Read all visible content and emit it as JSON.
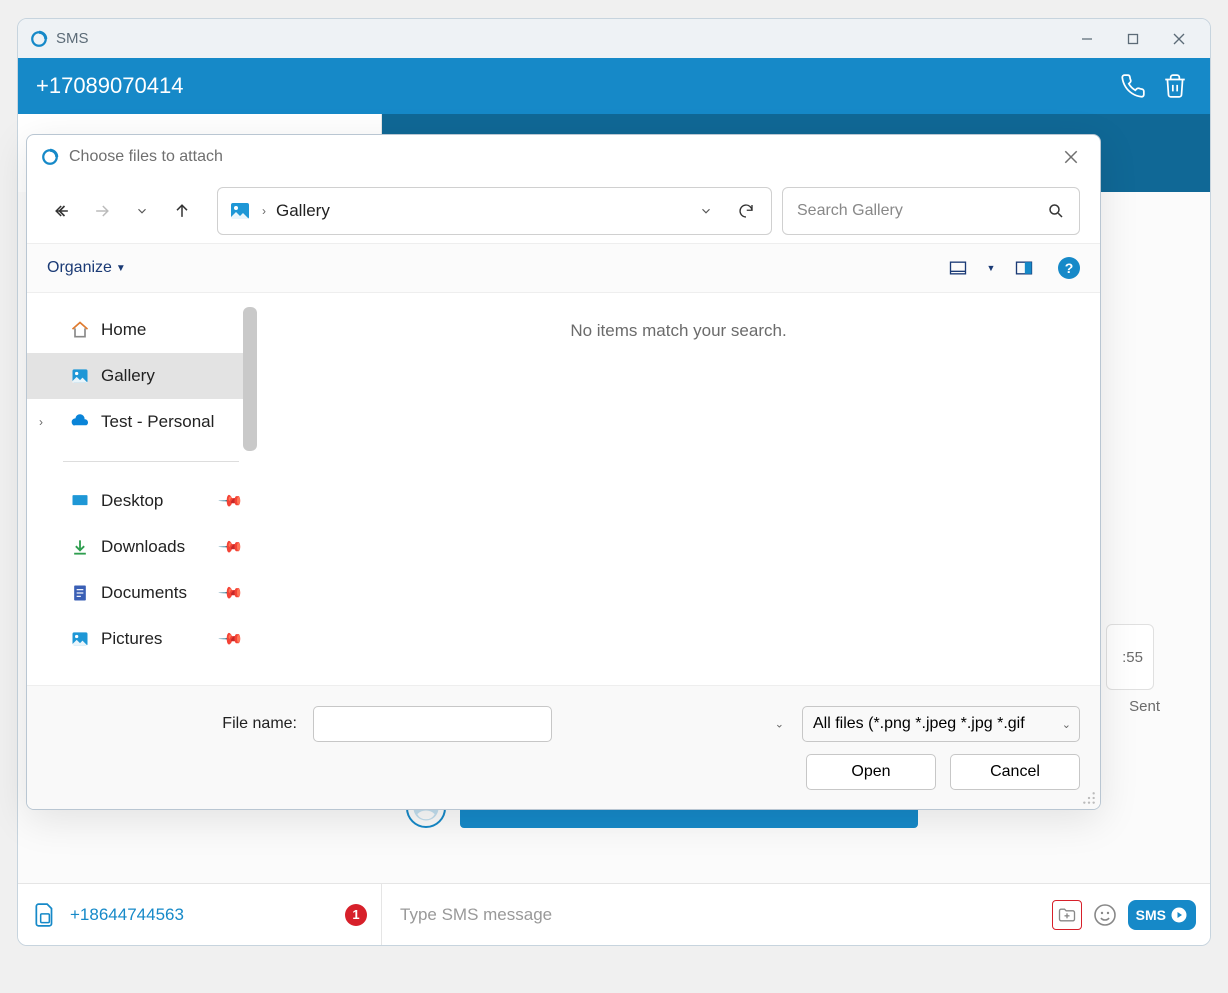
{
  "window": {
    "title": "SMS"
  },
  "conversation": {
    "phone": "+17089070414",
    "message_time_suffix": ":55",
    "message_status": "Sent"
  },
  "footer": {
    "own_number": "+18644744563",
    "badge_count": "1",
    "compose_placeholder": "Type SMS message",
    "send_label": "SMS"
  },
  "dialog": {
    "title": "Choose files to attach",
    "breadcrumb": {
      "location": "Gallery"
    },
    "search_placeholder": "Search Gallery",
    "toolbar": {
      "organize_label": "Organize",
      "help_symbol": "?"
    },
    "sidebar": {
      "items": [
        {
          "label": "Home",
          "icon": "home",
          "selected": false,
          "pinned": false,
          "expandable": false
        },
        {
          "label": "Gallery",
          "icon": "gallery",
          "selected": true,
          "pinned": false,
          "expandable": false
        },
        {
          "label": "Test - Personal",
          "icon": "onedrive",
          "selected": false,
          "pinned": false,
          "expandable": true
        }
      ],
      "quick_access": [
        {
          "label": "Desktop",
          "icon": "desktop",
          "pinned": true
        },
        {
          "label": "Downloads",
          "icon": "downloads",
          "pinned": true
        },
        {
          "label": "Documents",
          "icon": "documents",
          "pinned": true
        },
        {
          "label": "Pictures",
          "icon": "pictures",
          "pinned": true
        }
      ]
    },
    "content_empty_message": "No items match your search.",
    "footer": {
      "file_name_label": "File name:",
      "file_name_value": "",
      "filter_label": "All files (*.png *.jpeg *.jpg *.gif",
      "open_label": "Open",
      "cancel_label": "Cancel"
    }
  }
}
